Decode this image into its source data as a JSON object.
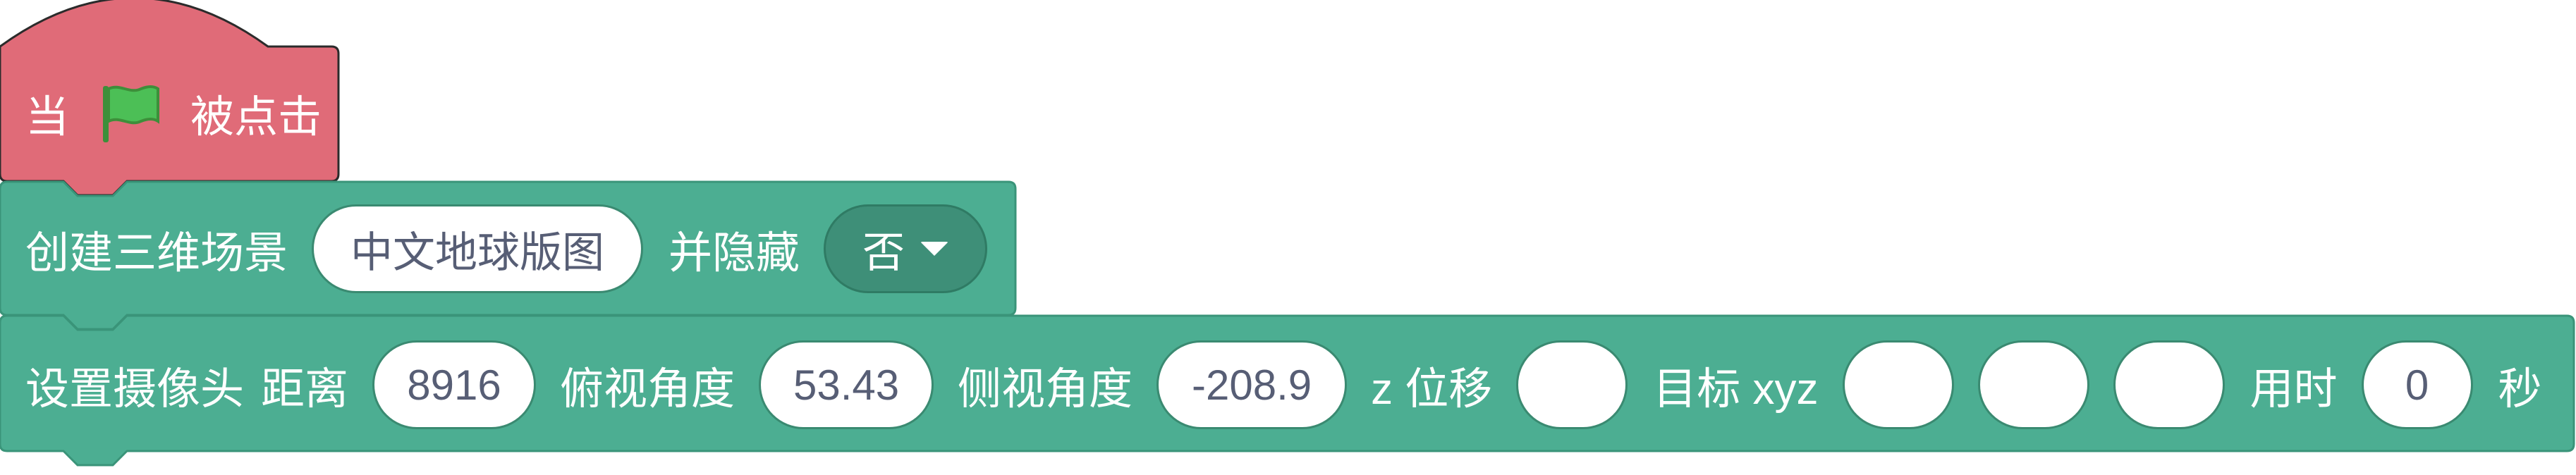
{
  "hat_block": {
    "prefix": "当",
    "icon": "green-flag-icon",
    "suffix": "被点击",
    "color": "#e06b78"
  },
  "create_scene_block": {
    "label": "创建三维场景",
    "map_value": "中文地球版图",
    "hide_label": "并隐藏",
    "hide_value": "否",
    "color": "#4cae92"
  },
  "camera_block": {
    "label": "设置摄像头",
    "distance_label": "距离",
    "distance_value": "8916",
    "pitch_label": "俯视角度",
    "pitch_value": "53.43",
    "side_label": "侧视角度",
    "side_value": "-208.9",
    "z_label": "z 位移",
    "z_value": "",
    "target_label": "目标 xyz",
    "target_x": "",
    "target_y": "",
    "target_z": "",
    "duration_label": "用时",
    "duration_value": "0",
    "seconds_label": "秒",
    "color": "#4cae92"
  }
}
